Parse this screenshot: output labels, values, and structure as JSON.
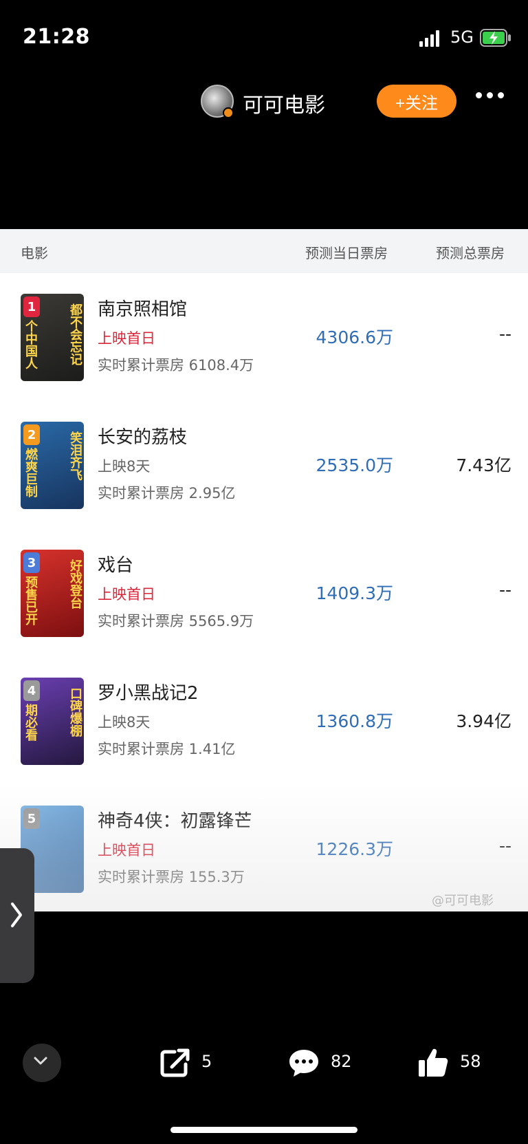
{
  "status_bar": {
    "time": "21:28",
    "network": "5G"
  },
  "header": {
    "account_name": "可可电影",
    "follow_label": "+关注"
  },
  "table": {
    "headers": {
      "movie": "电影",
      "day_forecast": "预测当日票房",
      "total_forecast": "预测总票房"
    },
    "rows": [
      {
        "rank": "1",
        "title": "南京照相馆",
        "status": "上映首日",
        "cumulative": "实时累计票房 6108.4万",
        "day": "4306.6万",
        "total": "--",
        "poster_colors": [
          "#3b3a36",
          "#1c1c1a"
        ],
        "rank_color": "#e0263f"
      },
      {
        "rank": "2",
        "title": "长安的荔枝",
        "status": "上映8天",
        "cumulative": "实时累计票房 2.95亿",
        "day": "2535.0万",
        "total": "7.43亿",
        "poster_colors": [
          "#2a6aa8",
          "#17345e"
        ],
        "rank_color": "#f39a1f"
      },
      {
        "rank": "3",
        "title": "戏台",
        "status": "上映首日",
        "cumulative": "实时累计票房 5565.9万",
        "day": "1409.3万",
        "total": "--",
        "poster_colors": [
          "#d8322c",
          "#7c0f10"
        ],
        "rank_color": "#4c7bd8"
      },
      {
        "rank": "4",
        "title": "罗小黑战记2",
        "status": "上映8天",
        "cumulative": "实时累计票房 1.41亿",
        "day": "1360.8万",
        "total": "3.94亿",
        "poster_colors": [
          "#6a3fb1",
          "#24183f"
        ],
        "rank_color": "#9a9a9a"
      },
      {
        "rank": "5",
        "title": "神奇4侠：初露锋芒",
        "status": "上映首日",
        "cumulative": "实时累计票房 155.3万",
        "day": "1226.3万",
        "total": "--",
        "poster_colors": [
          "#7fb4e3",
          "#2a5f9a"
        ],
        "rank_color": "#9a9a9a"
      }
    ],
    "poster_texts": [
      {
        "left": "个中国人",
        "right": "都不会忘记"
      },
      {
        "left": "燃爽巨制",
        "right": "笑泪齐飞"
      },
      {
        "left": "预售已开",
        "right": "好戏登台"
      },
      {
        "left": "期必看",
        "right": "口碑爆棚"
      },
      {
        "left": "",
        "right": ""
      }
    ]
  },
  "watermark": "@可可电影",
  "actions": {
    "share_count": "5",
    "comment_count": "82",
    "like_count": "58"
  }
}
